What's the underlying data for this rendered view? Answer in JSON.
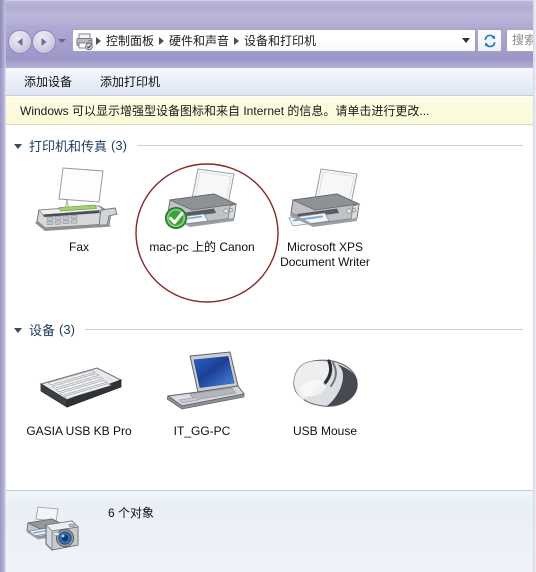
{
  "window": {
    "nav": {
      "back_label": "后退",
      "forward_label": "前进",
      "recent_label": "最近浏览的位置",
      "address_icon": "printer-icon",
      "breadcrumbs": [
        "控制面板",
        "硬件和声音",
        "设备和打印机"
      ],
      "dropdown_icon": "chevron-down-icon",
      "refresh_icon": "refresh-icon",
      "search_placeholder": "搜索 设备和打印机"
    },
    "toolbar": {
      "buttons": [
        {
          "label": "添加设备",
          "name": "add-device-button"
        },
        {
          "label": "添加打印机",
          "name": "add-printer-button"
        }
      ]
    },
    "infobar": {
      "text": "Windows 可以显示增强型设备图标和来自 Internet 的信息。请单击进行更改...",
      "background": "#fdfce4"
    }
  },
  "groups": [
    {
      "id": "printers",
      "title": "打印机和传真",
      "count": "(3)",
      "items": [
        {
          "label": "Fax",
          "icon": "fax-machine-icon",
          "badge": "none"
        },
        {
          "label": "mac-pc 上的 Canon",
          "icon": "printer-icon",
          "badge": "default-printer-check"
        },
        {
          "label": "Microsoft XPS Document Writer",
          "icon": "printer-icon",
          "badge": "none"
        }
      ]
    },
    {
      "id": "devices",
      "title": "设备",
      "count": "(3)",
      "items": [
        {
          "label": "GASIA USB KB Pro",
          "icon": "keyboard-icon",
          "badge": "none"
        },
        {
          "label": "IT_GG-PC",
          "icon": "laptop-icon",
          "badge": "none"
        },
        {
          "label": "USB Mouse",
          "icon": "mouse-icon",
          "badge": "none"
        }
      ]
    }
  ],
  "statusbar": {
    "icon": "printer-camera-icon",
    "text": "6 个对象"
  },
  "annotation": {
    "shape": "ellipse",
    "color": "#8b2526",
    "target": "mac-pc 上的 Canon"
  },
  "colors": {
    "glass": "#a9a4cf",
    "accent": "#1f3a5f",
    "info_bg": "#fdfce4",
    "annotation": "#8b2526",
    "default_badge": "#3da33d"
  }
}
